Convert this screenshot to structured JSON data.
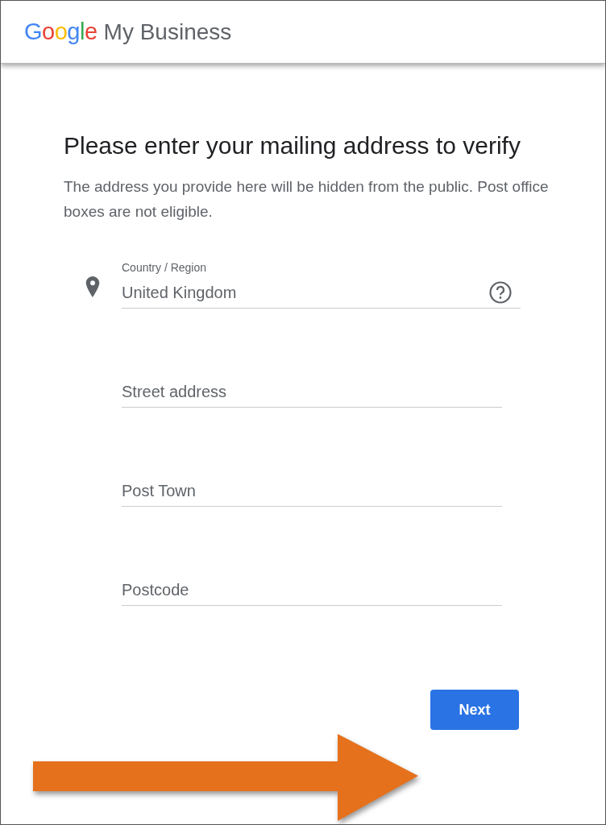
{
  "header": {
    "logo": "Google",
    "product": "My Business"
  },
  "heading": "Please enter your mailing address to verify",
  "description": "The address you provide here will be hidden from the public. Post office boxes are not eligible.",
  "fields": [
    {
      "kind": "select",
      "label": "Country / Region",
      "value": "United Kingdom"
    },
    {
      "kind": "text",
      "placeholder": "Street address"
    },
    {
      "kind": "text",
      "placeholder": "Post Town"
    },
    {
      "kind": "text",
      "placeholder": "Postcode"
    }
  ],
  "next_button": "Next"
}
